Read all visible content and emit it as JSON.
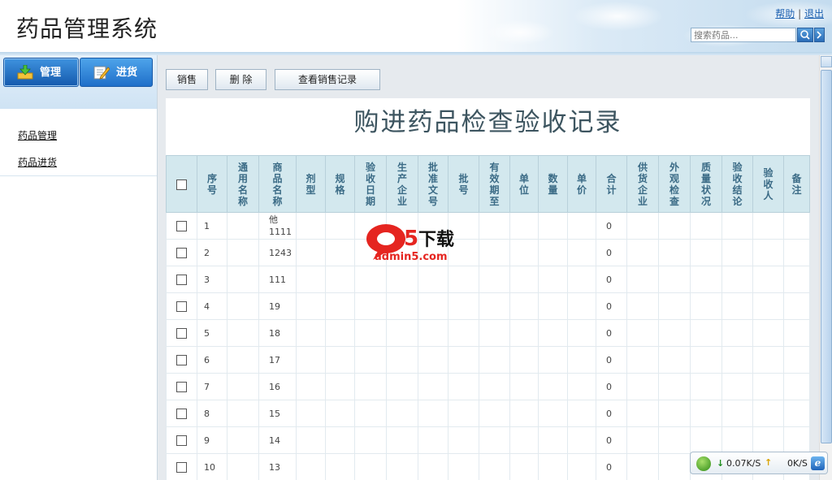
{
  "header": {
    "app_title": "药品管理系统",
    "help_link": "帮助",
    "separator": "|",
    "logout_link": "退出",
    "search_placeholder": "搜索药品..."
  },
  "sidebar": {
    "tabs": [
      {
        "label": "管理",
        "icon": "download-tray-icon",
        "active": true
      },
      {
        "label": "进货",
        "icon": "edit-document-icon",
        "active": false
      }
    ],
    "links": [
      "药品管理",
      "药品进货"
    ]
  },
  "toolbar": {
    "sell_label": "销售",
    "delete_label": "删 除",
    "view_sales_label": "查看销售记录"
  },
  "report": {
    "title": "购进药品检查验收记录",
    "columns": [
      "序号",
      "通用名称",
      "商品名称",
      "剂型",
      "规格",
      "验收日期",
      "生产企业",
      "批准文号",
      "批号",
      "有效期至",
      "单位",
      "数量",
      "单价",
      "合计",
      "供货企业",
      "外观检查",
      "质量状况",
      "验收结论",
      "验收人",
      "备注"
    ],
    "rows": [
      {
        "no": "1",
        "name": "他1111",
        "total": "0"
      },
      {
        "no": "2",
        "name": "1243",
        "total": "0"
      },
      {
        "no": "3",
        "name": "111",
        "total": "0"
      },
      {
        "no": "4",
        "name": "19",
        "total": "0"
      },
      {
        "no": "5",
        "name": "18",
        "total": "0"
      },
      {
        "no": "6",
        "name": "17",
        "total": "0"
      },
      {
        "no": "7",
        "name": "16",
        "total": "0"
      },
      {
        "no": "8",
        "name": "15",
        "total": "0"
      },
      {
        "no": "9",
        "name": "14",
        "total": "0"
      },
      {
        "no": "10",
        "name": "13",
        "total": "0"
      }
    ]
  },
  "watermark": {
    "logo_text": "a5下载",
    "site": "admin5.com"
  },
  "speed_widget": {
    "download": "0.07K/S",
    "upload": "0K/S"
  },
  "colors": {
    "header_blue": "#1f6fc9",
    "table_header_bg": "#d3e8ee",
    "table_header_text": "#3b6b86",
    "title_text": "#3d5560"
  }
}
